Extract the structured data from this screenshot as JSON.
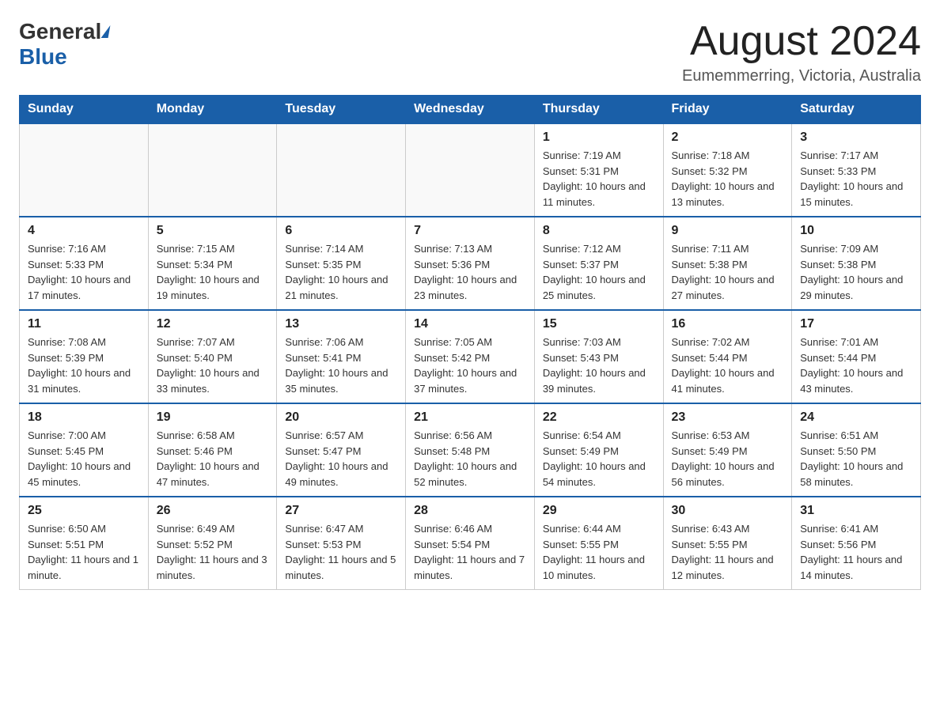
{
  "logo": {
    "general": "General",
    "blue": "Blue",
    "line2": "Blue"
  },
  "header": {
    "month_year": "August 2024",
    "location": "Eumemmerring, Victoria, Australia"
  },
  "weekdays": [
    "Sunday",
    "Monday",
    "Tuesday",
    "Wednesday",
    "Thursday",
    "Friday",
    "Saturday"
  ],
  "weeks": [
    [
      {
        "day": "",
        "info": ""
      },
      {
        "day": "",
        "info": ""
      },
      {
        "day": "",
        "info": ""
      },
      {
        "day": "",
        "info": ""
      },
      {
        "day": "1",
        "info": "Sunrise: 7:19 AM\nSunset: 5:31 PM\nDaylight: 10 hours and 11 minutes."
      },
      {
        "day": "2",
        "info": "Sunrise: 7:18 AM\nSunset: 5:32 PM\nDaylight: 10 hours and 13 minutes."
      },
      {
        "day": "3",
        "info": "Sunrise: 7:17 AM\nSunset: 5:33 PM\nDaylight: 10 hours and 15 minutes."
      }
    ],
    [
      {
        "day": "4",
        "info": "Sunrise: 7:16 AM\nSunset: 5:33 PM\nDaylight: 10 hours and 17 minutes."
      },
      {
        "day": "5",
        "info": "Sunrise: 7:15 AM\nSunset: 5:34 PM\nDaylight: 10 hours and 19 minutes."
      },
      {
        "day": "6",
        "info": "Sunrise: 7:14 AM\nSunset: 5:35 PM\nDaylight: 10 hours and 21 minutes."
      },
      {
        "day": "7",
        "info": "Sunrise: 7:13 AM\nSunset: 5:36 PM\nDaylight: 10 hours and 23 minutes."
      },
      {
        "day": "8",
        "info": "Sunrise: 7:12 AM\nSunset: 5:37 PM\nDaylight: 10 hours and 25 minutes."
      },
      {
        "day": "9",
        "info": "Sunrise: 7:11 AM\nSunset: 5:38 PM\nDaylight: 10 hours and 27 minutes."
      },
      {
        "day": "10",
        "info": "Sunrise: 7:09 AM\nSunset: 5:38 PM\nDaylight: 10 hours and 29 minutes."
      }
    ],
    [
      {
        "day": "11",
        "info": "Sunrise: 7:08 AM\nSunset: 5:39 PM\nDaylight: 10 hours and 31 minutes."
      },
      {
        "day": "12",
        "info": "Sunrise: 7:07 AM\nSunset: 5:40 PM\nDaylight: 10 hours and 33 minutes."
      },
      {
        "day": "13",
        "info": "Sunrise: 7:06 AM\nSunset: 5:41 PM\nDaylight: 10 hours and 35 minutes."
      },
      {
        "day": "14",
        "info": "Sunrise: 7:05 AM\nSunset: 5:42 PM\nDaylight: 10 hours and 37 minutes."
      },
      {
        "day": "15",
        "info": "Sunrise: 7:03 AM\nSunset: 5:43 PM\nDaylight: 10 hours and 39 minutes."
      },
      {
        "day": "16",
        "info": "Sunrise: 7:02 AM\nSunset: 5:44 PM\nDaylight: 10 hours and 41 minutes."
      },
      {
        "day": "17",
        "info": "Sunrise: 7:01 AM\nSunset: 5:44 PM\nDaylight: 10 hours and 43 minutes."
      }
    ],
    [
      {
        "day": "18",
        "info": "Sunrise: 7:00 AM\nSunset: 5:45 PM\nDaylight: 10 hours and 45 minutes."
      },
      {
        "day": "19",
        "info": "Sunrise: 6:58 AM\nSunset: 5:46 PM\nDaylight: 10 hours and 47 minutes."
      },
      {
        "day": "20",
        "info": "Sunrise: 6:57 AM\nSunset: 5:47 PM\nDaylight: 10 hours and 49 minutes."
      },
      {
        "day": "21",
        "info": "Sunrise: 6:56 AM\nSunset: 5:48 PM\nDaylight: 10 hours and 52 minutes."
      },
      {
        "day": "22",
        "info": "Sunrise: 6:54 AM\nSunset: 5:49 PM\nDaylight: 10 hours and 54 minutes."
      },
      {
        "day": "23",
        "info": "Sunrise: 6:53 AM\nSunset: 5:49 PM\nDaylight: 10 hours and 56 minutes."
      },
      {
        "day": "24",
        "info": "Sunrise: 6:51 AM\nSunset: 5:50 PM\nDaylight: 10 hours and 58 minutes."
      }
    ],
    [
      {
        "day": "25",
        "info": "Sunrise: 6:50 AM\nSunset: 5:51 PM\nDaylight: 11 hours and 1 minute."
      },
      {
        "day": "26",
        "info": "Sunrise: 6:49 AM\nSunset: 5:52 PM\nDaylight: 11 hours and 3 minutes."
      },
      {
        "day": "27",
        "info": "Sunrise: 6:47 AM\nSunset: 5:53 PM\nDaylight: 11 hours and 5 minutes."
      },
      {
        "day": "28",
        "info": "Sunrise: 6:46 AM\nSunset: 5:54 PM\nDaylight: 11 hours and 7 minutes."
      },
      {
        "day": "29",
        "info": "Sunrise: 6:44 AM\nSunset: 5:55 PM\nDaylight: 11 hours and 10 minutes."
      },
      {
        "day": "30",
        "info": "Sunrise: 6:43 AM\nSunset: 5:55 PM\nDaylight: 11 hours and 12 minutes."
      },
      {
        "day": "31",
        "info": "Sunrise: 6:41 AM\nSunset: 5:56 PM\nDaylight: 11 hours and 14 minutes."
      }
    ]
  ]
}
